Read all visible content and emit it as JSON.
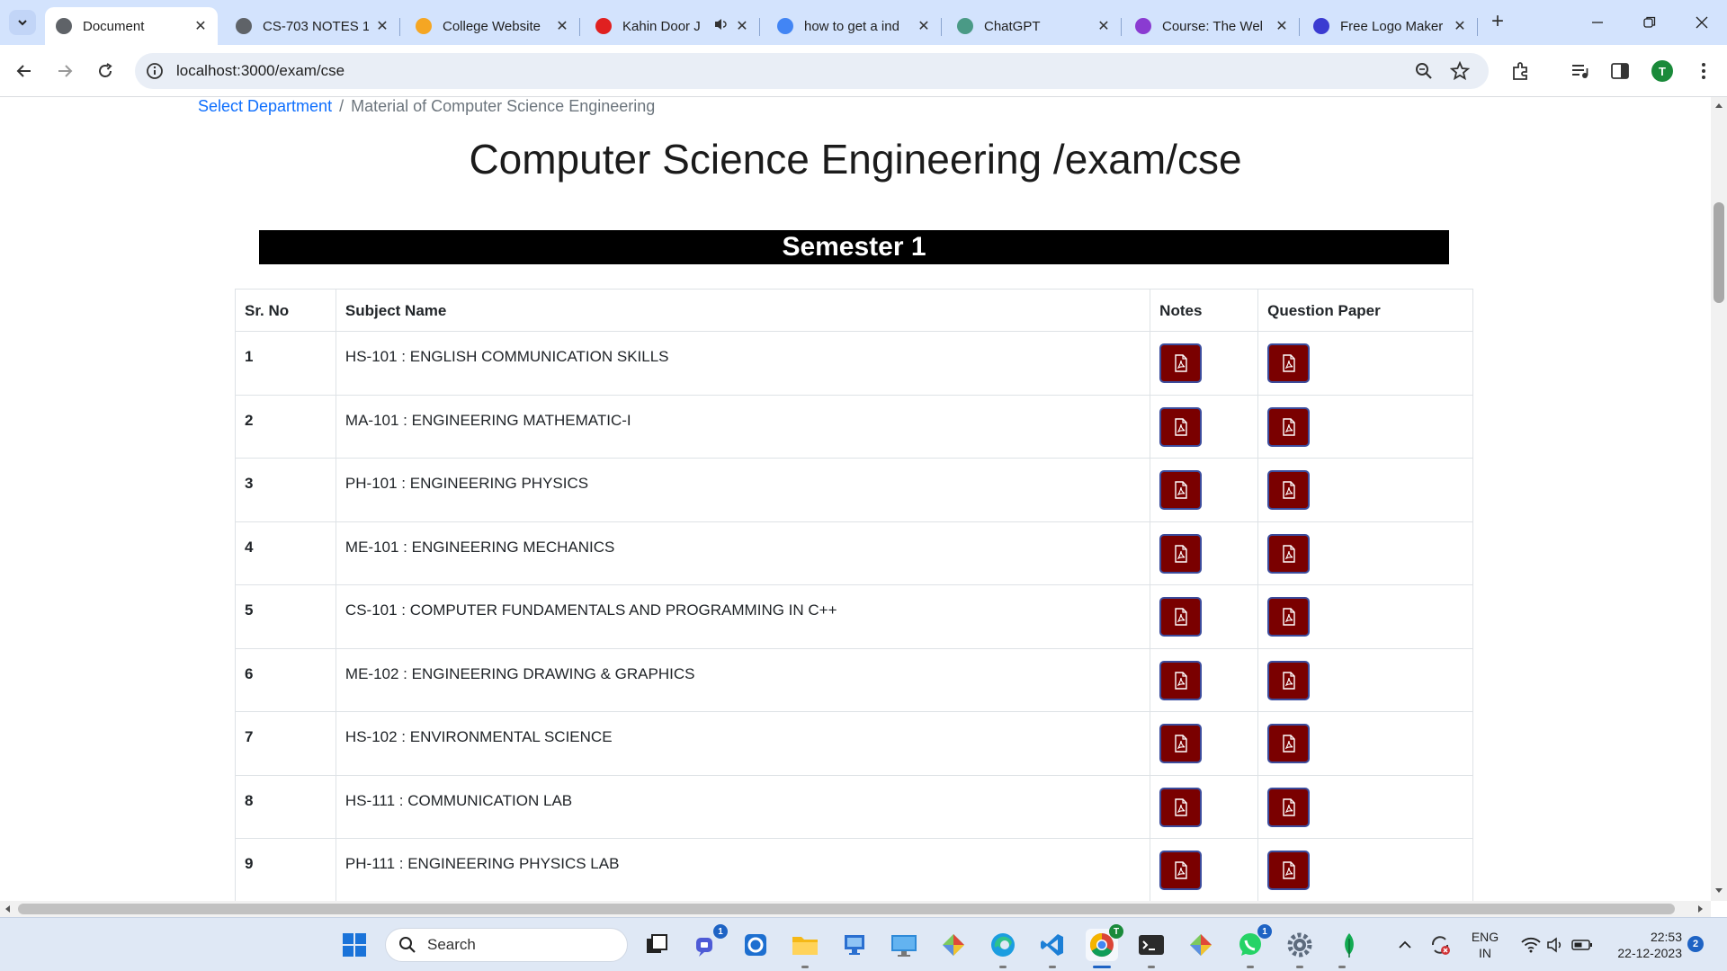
{
  "browser": {
    "tabs": [
      {
        "title": "Document",
        "favicon": "globe-icon",
        "color": "#5f6368",
        "active": true
      },
      {
        "title": "CS-703 NOTES 1",
        "favicon": "globe-icon",
        "color": "#5f6368",
        "active": false
      },
      {
        "title": "College Website",
        "favicon": "firebase-icon",
        "color": "#f5a623",
        "active": false
      },
      {
        "title": "Kahin Door J",
        "favicon": "youtube-icon",
        "color": "#e02020",
        "active": false,
        "audio": true
      },
      {
        "title": "how to get a ind",
        "favicon": "google-icon",
        "color": "#4285f4",
        "active": false
      },
      {
        "title": "ChatGPT",
        "favicon": "chatgpt-icon",
        "color": "#4a9a86",
        "active": false
      },
      {
        "title": "Course: The Wel",
        "favicon": "course-icon",
        "color": "#8a3bd1",
        "active": false
      },
      {
        "title": "Free Logo Maker",
        "favicon": "logo-maker-icon",
        "color": "#3b3bd1",
        "active": false
      }
    ],
    "url": "localhost:3000/exam/cse",
    "profile_initial": "T"
  },
  "page": {
    "breadcrumb": {
      "link": "Select Department",
      "separator": "/",
      "current": "Material of Computer Science Engineering"
    },
    "title": "Computer Science Engineering /exam/cse",
    "semester": "Semester 1",
    "table": {
      "headers": [
        "Sr. No",
        "Subject Name",
        "Notes",
        "Question Paper"
      ],
      "rows": [
        {
          "no": "1",
          "subject": "HS-101 : ENGLISH COMMUNICATION SKILLS"
        },
        {
          "no": "2",
          "subject": "MA-101 : ENGINEERING MATHEMATIC-I"
        },
        {
          "no": "3",
          "subject": "PH-101 : ENGINEERING PHYSICS"
        },
        {
          "no": "4",
          "subject": "ME-101 : ENGINEERING MECHANICS"
        },
        {
          "no": "5",
          "subject": "CS-101 : COMPUTER FUNDAMENTALS AND PROGRAMMING IN C++"
        },
        {
          "no": "6",
          "subject": "ME-102 : ENGINEERING DRAWING & GRAPHICS"
        },
        {
          "no": "7",
          "subject": "HS-102 : ENVIRONMENTAL SCIENCE"
        },
        {
          "no": "8",
          "subject": "HS-111 : COMMUNICATION LAB"
        },
        {
          "no": "9",
          "subject": "PH-111 : ENGINEERING PHYSICS LAB"
        }
      ],
      "button_icon": "pdf-file-icon",
      "button_color": "#7a0000"
    }
  },
  "taskbar": {
    "search_placeholder": "Search",
    "language": "ENG",
    "region": "IN",
    "time": "22:53",
    "date": "22-12-2023",
    "notification_count": "2",
    "meet_badge": "1",
    "whatsapp_badge": "1",
    "chrome_badge": "T"
  }
}
